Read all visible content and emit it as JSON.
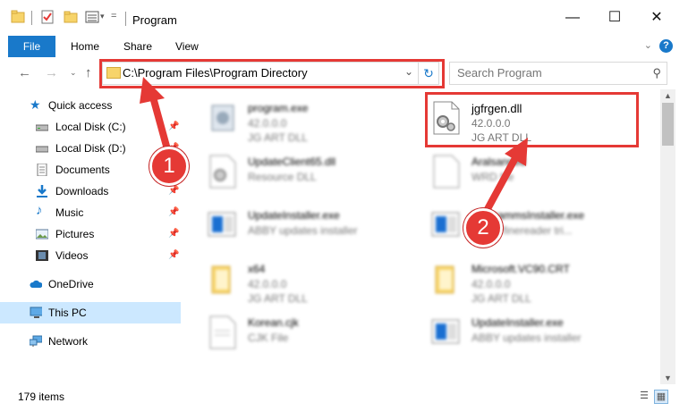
{
  "window": {
    "title": "Program",
    "controls": {
      "minimize": "—",
      "maximize": "☐",
      "close": "✕"
    }
  },
  "ribbon": {
    "file_tab": "File",
    "tabs": [
      "Home",
      "Share",
      "View"
    ],
    "help": "?"
  },
  "address_bar": {
    "path": "C:\\Program Files\\Program Directory",
    "highlight_color": "#e53935"
  },
  "search": {
    "placeholder": "Search Program"
  },
  "navigation": {
    "quick_access": "Quick access",
    "items": [
      {
        "label": "Local Disk (C:)",
        "icon": "drive-icon",
        "pinned": true
      },
      {
        "label": "Local Disk (D:)",
        "icon": "drive-icon",
        "pinned": true
      },
      {
        "label": "Documents",
        "icon": "documents-icon",
        "pinned": true
      },
      {
        "label": "Downloads",
        "icon": "downloads-icon",
        "pinned": true
      },
      {
        "label": "Music",
        "icon": "music-icon",
        "pinned": true
      },
      {
        "label": "Pictures",
        "icon": "pictures-icon",
        "pinned": true
      },
      {
        "label": "Videos",
        "icon": "videos-icon",
        "pinned": true
      }
    ],
    "onedrive": "OneDrive",
    "this_pc": "This PC",
    "network": "Network"
  },
  "files": [
    {
      "name": "program.exe",
      "line2": "42.0.0.0",
      "line3": "JG ART DLL",
      "icon": "exe-icon",
      "blurred": true
    },
    {
      "name": "jgfrgen.dll",
      "line2": "42.0.0.0",
      "line3": "JG ART DLL",
      "icon": "dll-gear-icon",
      "blurred": false
    },
    {
      "name": "UpdateClient65.dll",
      "line2": "Resource DLL",
      "line3": "",
      "icon": "dll-gear-icon",
      "blurred": true
    },
    {
      "name": "Aralsanned",
      "line2": "WRD file",
      "line3": "",
      "icon": "document-icon",
      "blurred": true
    },
    {
      "name": "UpdateInstaller.exe",
      "line2": "ABBY updates installer",
      "line3": "",
      "icon": "installer-icon",
      "blurred": true
    },
    {
      "name": "ProgrammsInstaller.exe",
      "line2": "ABBY finereader tri...",
      "line3": "",
      "icon": "installer-icon",
      "blurred": true
    },
    {
      "name": "x64",
      "line2": "42.0.0.0",
      "line3": "JG ART DLL",
      "icon": "folder-icon",
      "blurred": true
    },
    {
      "name": "Microsoft.VC90.CRT",
      "line2": "42.0.0.0",
      "line3": "JG ART DLL",
      "icon": "folder-icon",
      "blurred": true
    },
    {
      "name": "Korean.cjk",
      "line2": "CJK File",
      "line3": "",
      "icon": "document-icon",
      "blurred": true
    },
    {
      "name": "UpdateInstaller.exe",
      "line2": "ABBY updates installer",
      "line3": "",
      "icon": "installer-icon",
      "blurred": true
    }
  ],
  "status": {
    "item_count": "179 items"
  },
  "annotations": {
    "step1": "1",
    "step2": "2",
    "color": "#e53935"
  }
}
